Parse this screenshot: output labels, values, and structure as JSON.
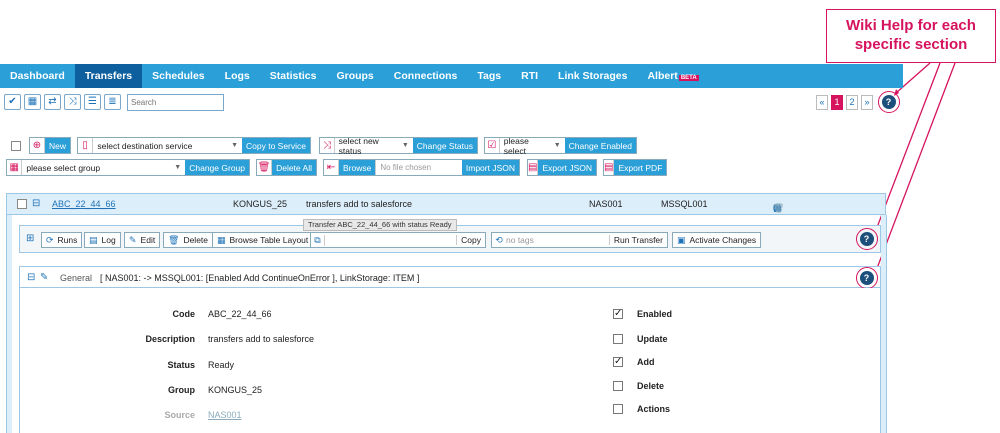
{
  "callout": {
    "line1": "Wiki Help for each",
    "line2": "specific section"
  },
  "nav": {
    "items": [
      "Dashboard",
      "Transfers",
      "Schedules",
      "Logs",
      "Statistics",
      "Groups",
      "Connections",
      "Tags",
      "RTI",
      "Link Storages",
      "Albert"
    ],
    "active": "Transfers",
    "beta_badge": "BETA"
  },
  "toolbar": {
    "search_placeholder": "Search",
    "pager": {
      "prev": "«",
      "pages": [
        "1",
        "2"
      ],
      "next": "»",
      "current": "1"
    },
    "help": "?"
  },
  "actions": {
    "new_label": "New",
    "destination_select": "select destination service",
    "copy_to_service": "Copy to Service",
    "status_select": "select new status",
    "change_status": "Change Status",
    "enabled_select": "please select",
    "change_enabled": "Change Enabled",
    "group_select": "please select group",
    "change_group": "Change Group",
    "delete_all": "Delete All",
    "browse": "Browse",
    "no_file": "No file chosen",
    "import_json": "Import JSON",
    "export_json": "Export JSON",
    "export_pdf": "Export PDF"
  },
  "transfer_row": {
    "code": "ABC_22_44_66",
    "group": "KONGUS_25",
    "description": "transfers add to salesforce",
    "source": "NAS001",
    "target": "MSSQL001"
  },
  "tooltip": "Transfer ABC_22_44_66 with status Ready",
  "sub_toolbar": {
    "runs": "Runs",
    "log": "Log",
    "edit": "Edit",
    "delete": "Delete",
    "browse_table_layout": "Browse Table Layout",
    "copy": "Copy",
    "tags_placeholder": "no tags",
    "run_transfer": "Run Transfer",
    "activate_changes": "Activate Changes"
  },
  "general": {
    "title": "General",
    "summary": "[ NAS001: -> MSSQL001: [Enabled Add ContinueOnError ], LinkStorage: ITEM ]",
    "fields": [
      {
        "label": "Code",
        "value": "ABC_22_44_66"
      },
      {
        "label": "Description",
        "value": "transfers add to salesforce"
      },
      {
        "label": "Status",
        "value": "Ready"
      },
      {
        "label": "Group",
        "value": "KONGUS_25"
      },
      {
        "label": "Source",
        "value": "NAS001"
      }
    ],
    "flags": [
      {
        "label": "Enabled",
        "checked": true
      },
      {
        "label": "Update",
        "checked": false
      },
      {
        "label": "Add",
        "checked": true
      },
      {
        "label": "Delete",
        "checked": false
      },
      {
        "label": "Actions",
        "checked": false
      }
    ]
  },
  "colors": {
    "accent": "#2a9fd8",
    "nav_active": "#0d5f9e",
    "highlight": "#d6135e"
  }
}
